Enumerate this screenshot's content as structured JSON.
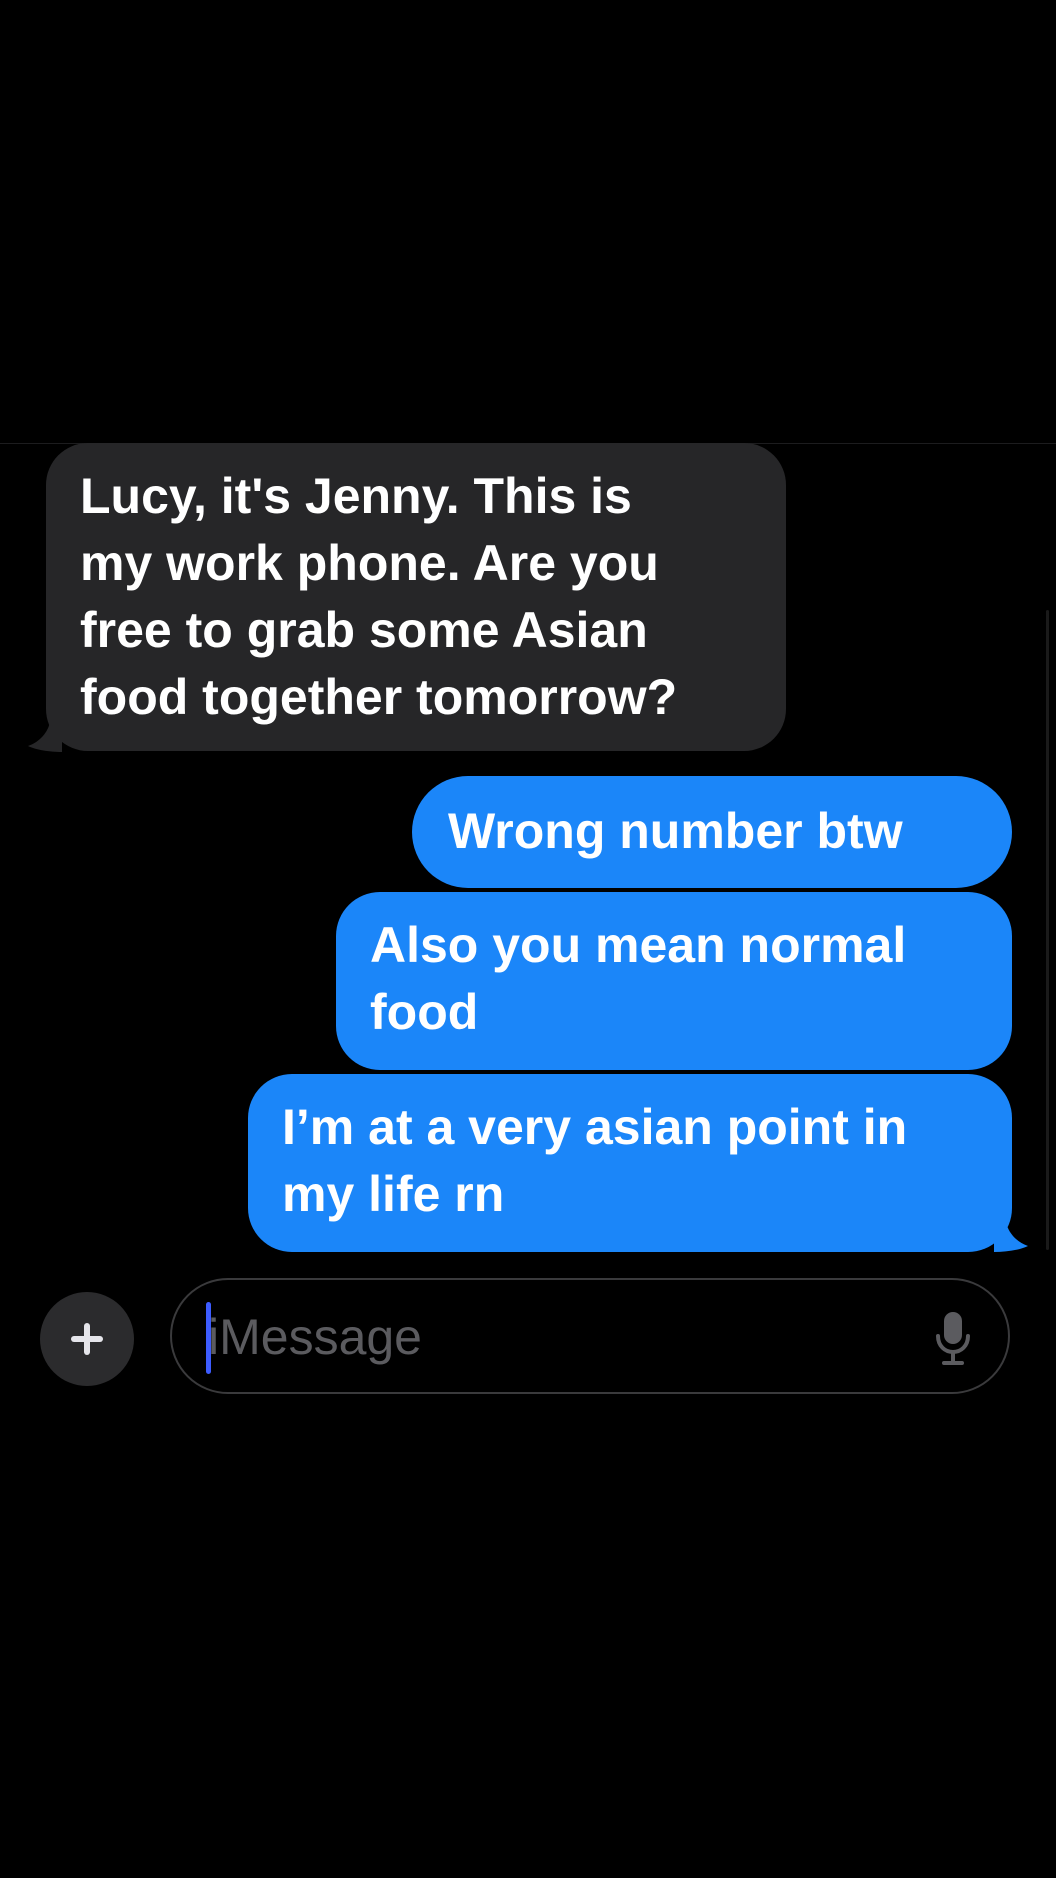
{
  "conversation": {
    "messages": [
      {
        "direction": "received",
        "text": "Lucy, it's Jenny. This is\nmy work phone. Are you\nfree to grab some Asian\nfood together tomorrow?"
      },
      {
        "direction": "sent",
        "text": "Wrong number btw"
      },
      {
        "direction": "sent",
        "text": "Also you mean normal\nfood"
      },
      {
        "direction": "sent",
        "text": "I’m at a very asian point in\nmy life rn"
      }
    ]
  },
  "composer": {
    "placeholder": "iMessage",
    "add_icon": "plus-icon",
    "mic_icon": "microphone-icon"
  },
  "colors": {
    "background": "#000000",
    "received_bubble": "#262628",
    "sent_bubble": "#1b86f9",
    "caret": "#3d5cff"
  }
}
